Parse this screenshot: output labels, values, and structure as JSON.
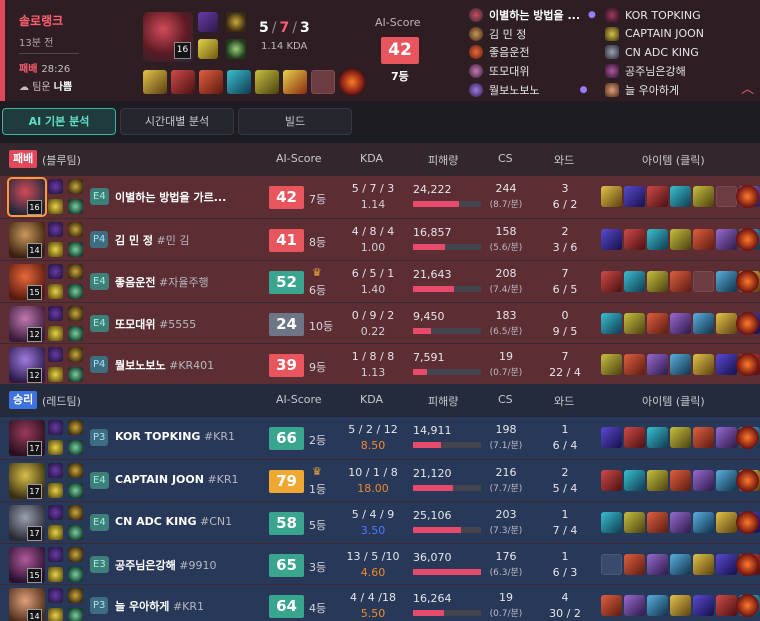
{
  "summary": {
    "queue_type": "솔로랭크",
    "time_ago": "13분 전",
    "result": "패배",
    "duration": "28:26",
    "luck_label": "팀운",
    "luck_value": "나쁨",
    "champion_level": "16",
    "kda_k": "5",
    "kda_d": "7",
    "kda_a": "3",
    "kda_ratio": "1.14 KDA",
    "ai_score_label": "AI-Score",
    "ai_score": "42",
    "ai_rank": "7등",
    "blue_players": [
      "이별하는 방법을 ...",
      "김 민 정",
      "좋음운전",
      "또모대위",
      "뭘보노보노"
    ],
    "red_players": [
      "KOR TOPKING",
      "CAPTAIN JOON",
      "CN ADC KING",
      "공주님은강해",
      "늘 우아하게"
    ],
    "items": [
      "galeforce",
      "runaan",
      "infinity-edge",
      "berserker",
      "navori",
      "ward-totem",
      "empty",
      "poro-icon"
    ]
  },
  "tabs": [
    {
      "label": "AI 기본 분석",
      "active": true
    },
    {
      "label": "시간대별 분석",
      "active": false
    },
    {
      "label": "빌드",
      "active": false
    }
  ],
  "columns": {
    "ai_score": "AI-Score",
    "kda": "KDA",
    "damage": "피해량",
    "cs": "CS",
    "ward": "와드",
    "items": "아이템 (클릭)"
  },
  "teams": [
    {
      "badge": "패배",
      "name": "(블루팀)",
      "color": "#e0485c",
      "players": [
        {
          "level": "16",
          "tier": "E4",
          "name": "이별하는 방법을 가르...",
          "tag": "",
          "score": "42",
          "rank": "7등",
          "kda": "5 / 7 / 3",
          "ratio": "1.14",
          "damage": "24,222",
          "dmg_frac": 0.67,
          "cs": "244",
          "cspm": "(8.7/분)",
          "ward1": "3",
          "ward2": "6 / 2"
        },
        {
          "level": "14",
          "tier": "P4",
          "name": "김 민 정",
          "tag": "#민 김",
          "score": "41",
          "rank": "8등",
          "kda": "4 / 8 / 4",
          "ratio": "1.00",
          "damage": "16,857",
          "dmg_frac": 0.47,
          "cs": "158",
          "cspm": "(5.6/분)",
          "ward1": "2",
          "ward2": "3 / 6"
        },
        {
          "level": "15",
          "tier": "E4",
          "name": "좋음운전",
          "tag": "#자율주행",
          "score": "52",
          "rank": "6등",
          "kda": "6 / 5 / 1",
          "ratio": "1.40",
          "damage": "21,643",
          "dmg_frac": 0.6,
          "cs": "208",
          "cspm": "(7.4/분)",
          "ward1": "7",
          "ward2": "6 / 5"
        },
        {
          "level": "12",
          "tier": "E4",
          "name": "또모대위",
          "tag": "#5555",
          "score": "24",
          "rank": "10등",
          "kda": "0 / 9 / 2",
          "ratio": "0.22",
          "damage": "9,450",
          "dmg_frac": 0.26,
          "cs": "183",
          "cspm": "(6.5/분)",
          "ward1": "0",
          "ward2": "9 / 5"
        },
        {
          "level": "12",
          "tier": "P4",
          "name": "뭘보노보노",
          "tag": "#KR401",
          "score": "39",
          "rank": "9등",
          "kda": "1 / 8 / 8",
          "ratio": "1.13",
          "damage": "7,591",
          "dmg_frac": 0.21,
          "cs": "19",
          "cspm": "(0.7/분)",
          "ward1": "7",
          "ward2": "22 / 4"
        }
      ]
    },
    {
      "badge": "승리",
      "name": "(레드팀)",
      "color": "#3d72e0",
      "players": [
        {
          "level": "17",
          "tier": "P3",
          "name": "KOR TOPKING",
          "tag": "#KR1",
          "score": "66",
          "rank": "2등",
          "kda": "5 / 2 / 12",
          "ratio": "8.50",
          "damage": "14,911",
          "dmg_frac": 0.41,
          "cs": "198",
          "cspm": "(7.1/분)",
          "ward1": "1",
          "ward2": "6 / 4"
        },
        {
          "level": "17",
          "tier": "E4",
          "name": "CAPTAIN JOON",
          "tag": "#KR1",
          "score": "79",
          "rank": "1등",
          "kda": "10 / 1 / 8",
          "ratio": "18.00",
          "damage": "21,120",
          "dmg_frac": 0.59,
          "cs": "216",
          "cspm": "(7.7/분)",
          "ward1": "2",
          "ward2": "5 / 4"
        },
        {
          "level": "17",
          "tier": "E4",
          "name": "CN ADC KING",
          "tag": "#CN1",
          "score": "58",
          "rank": "5등",
          "kda": "5 / 4 / 9",
          "ratio": "3.50",
          "damage": "25,106",
          "dmg_frac": 0.7,
          "cs": "203",
          "cspm": "(7.3/분)",
          "ward1": "1",
          "ward2": "7 / 4"
        },
        {
          "level": "15",
          "tier": "E3",
          "name": "공주님은강해",
          "tag": "#9910",
          "score": "65",
          "rank": "3등",
          "kda": "13 / 5 /10",
          "ratio": "4.60",
          "damage": "36,070",
          "dmg_frac": 1.0,
          "cs": "176",
          "cspm": "(6.3/분)",
          "ward1": "1",
          "ward2": "6 / 3"
        },
        {
          "level": "14",
          "tier": "P3",
          "name": "늘 우아하게",
          "tag": "#KR1",
          "score": "64",
          "rank": "4등",
          "kda": "4 / 4 /18",
          "ratio": "5.50",
          "damage": "16,264",
          "dmg_frac": 0.45,
          "cs": "19",
          "cspm": "(0.7/분)",
          "ward1": "4",
          "ward2": "30 / 2"
        }
      ]
    }
  ],
  "colors": {
    "lose_row": "#5c2d33",
    "win_row": "#283858",
    "score_red": "#e8555c",
    "score_green": "#3aa58e",
    "score_gray": "#6d7686",
    "score_gold": "#f0a833",
    "ratio_orange": "#f08a2a",
    "ratio_blue": "#4a7bff",
    "crown": "#f2a83a"
  }
}
